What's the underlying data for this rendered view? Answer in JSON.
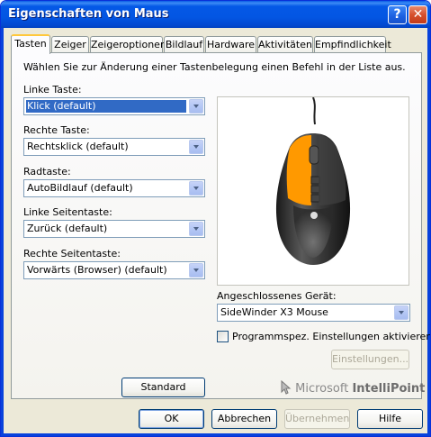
{
  "window": {
    "title": "Eigenschaften von Maus",
    "help_button": "?",
    "close_button": "✕"
  },
  "tabs": [
    {
      "label": "Tasten"
    },
    {
      "label": "Zeiger"
    },
    {
      "label": "Zeigeroptionen"
    },
    {
      "label": "Bildlauf"
    },
    {
      "label": "Hardware"
    },
    {
      "label": "Aktivitäten"
    },
    {
      "label": "Empfindlichkeit"
    }
  ],
  "buttons_tab": {
    "instruction": "Wählen Sie zur Änderung einer Tastenbelegung einen Befehl in der Liste aus.",
    "assignments": [
      {
        "label": "Linke Taste:",
        "value": "Klick (default)"
      },
      {
        "label": "Rechte Taste:",
        "value": "Rechtsklick (default)"
      },
      {
        "label": "Radtaste:",
        "value": "AutoBildlauf (default)"
      },
      {
        "label": "Linke Seitentaste:",
        "value": "Zurück (default)"
      },
      {
        "label": "Rechte Seitentaste:",
        "value": "Vorwärts (Browser) (default)"
      }
    ],
    "device_label": "Angeschlossenes Gerät:",
    "device_value": "SideWinder X3 Mouse",
    "program_settings_checkbox": {
      "label": "Programmspez. Einstellungen aktivieren",
      "checked": false
    },
    "settings_button": "Einstellungen...",
    "standard_button": "Standard",
    "brand_prefix": "Microsoft",
    "brand_name": "IntelliPoint",
    "highlight_color": "#ff9900"
  },
  "dialog_buttons": {
    "ok": "OK",
    "cancel": "Abbrechen",
    "apply": "Übernehmen",
    "help": "Hilfe"
  }
}
